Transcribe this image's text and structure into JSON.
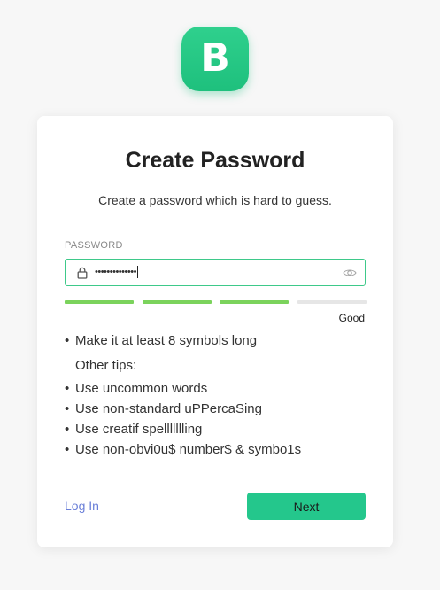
{
  "logo": {
    "letter": "B",
    "color": "#23c985"
  },
  "form": {
    "title": "Create Password",
    "subtitle": "Create a password which is hard to guess.",
    "password_label": "PASSWORD",
    "password_value": "••••••••••••••",
    "lock_icon": "lock-icon",
    "toggle_icon": "eye-icon"
  },
  "strength": {
    "segments_total": 4,
    "segments_filled": 3,
    "filled_color": "#7bd35c",
    "empty_color": "#e6e6e6",
    "label": "Good"
  },
  "tips": {
    "primary": "Make it at least 8 symbols long",
    "heading": "Other tips:",
    "others": [
      "Use uncommon words",
      "Use non-standard uPPercaSing",
      "Use creatif spellllllling",
      "Use non-obvi0u$ number$ & symbo1s"
    ],
    "bullet": "•"
  },
  "actions": {
    "login_label": "Log In",
    "next_label": "Next",
    "accent": "#24c78c",
    "link_color": "#6a7fd8"
  }
}
